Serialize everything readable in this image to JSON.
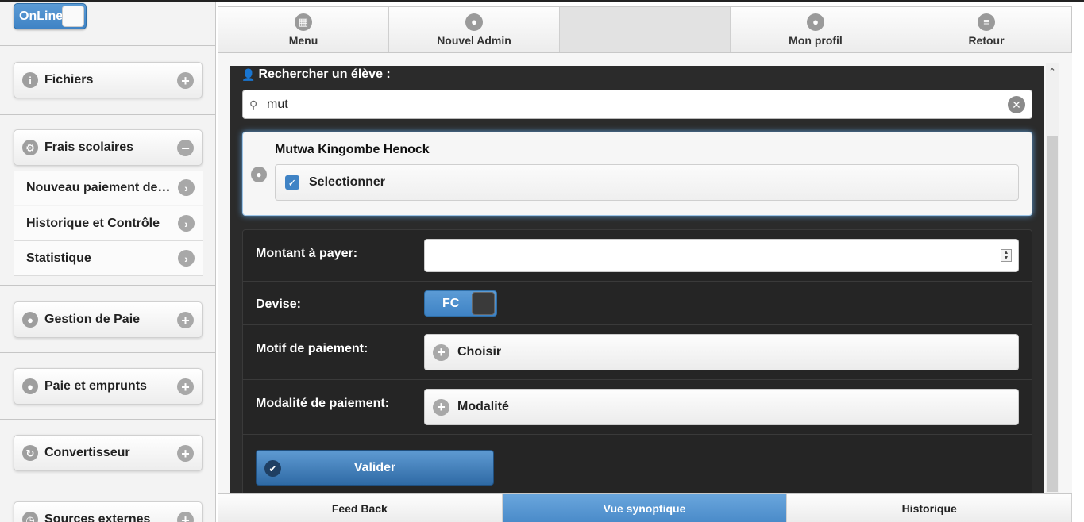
{
  "online": {
    "label": "OnLine"
  },
  "sidebar": {
    "sections": [
      {
        "label": "Fichiers",
        "icon": "info-icon",
        "action": "plus"
      },
      {
        "label": "Frais scolaires",
        "icon": "gear-icon",
        "action": "minus",
        "items": [
          {
            "label": "Nouveau paiement des frais"
          },
          {
            "label": "Historique et Contrôle"
          },
          {
            "label": "Statistique"
          }
        ]
      },
      {
        "label": "Gestion de Paie",
        "icon": "user-icon",
        "action": "plus"
      },
      {
        "label": "Paie et emprunts",
        "icon": "user-icon",
        "action": "plus"
      },
      {
        "label": "Convertisseur",
        "icon": "refresh-icon",
        "action": "plus"
      },
      {
        "label": "Sources externes",
        "icon": "clock-icon",
        "action": "plus"
      }
    ]
  },
  "navbar": {
    "items": [
      {
        "label": "Menu",
        "icon": "grid-icon"
      },
      {
        "label": "Nouvel Admin",
        "icon": "user-icon"
      },
      {
        "label": "",
        "icon": ""
      },
      {
        "label": "Mon profil",
        "icon": "user-icon"
      },
      {
        "label": "Retour",
        "icon": "bars-icon"
      }
    ]
  },
  "search": {
    "title": "Rechercher un élève :",
    "value": "mut",
    "result": {
      "name": "Mutwa Kingombe Henock",
      "select_label": "Selectionner",
      "checked": true
    }
  },
  "form": {
    "montant_label": "Montant à payer:",
    "montant_value": "",
    "devise_label": "Devise:",
    "devise_value": "FC",
    "motif_label": "Motif de paiement:",
    "motif_button": "Choisir",
    "modalite_label": "Modalité de paiement:",
    "modalite_button": "Modalité",
    "submit_label": "Valider"
  },
  "footer": {
    "tabs": [
      {
        "label": "Feed Back",
        "active": false
      },
      {
        "label": "Vue synoptique",
        "active": true
      },
      {
        "label": "Historique",
        "active": false
      }
    ]
  },
  "colors": {
    "accent": "#4a8bc9",
    "panel": "#2b2b2b"
  }
}
